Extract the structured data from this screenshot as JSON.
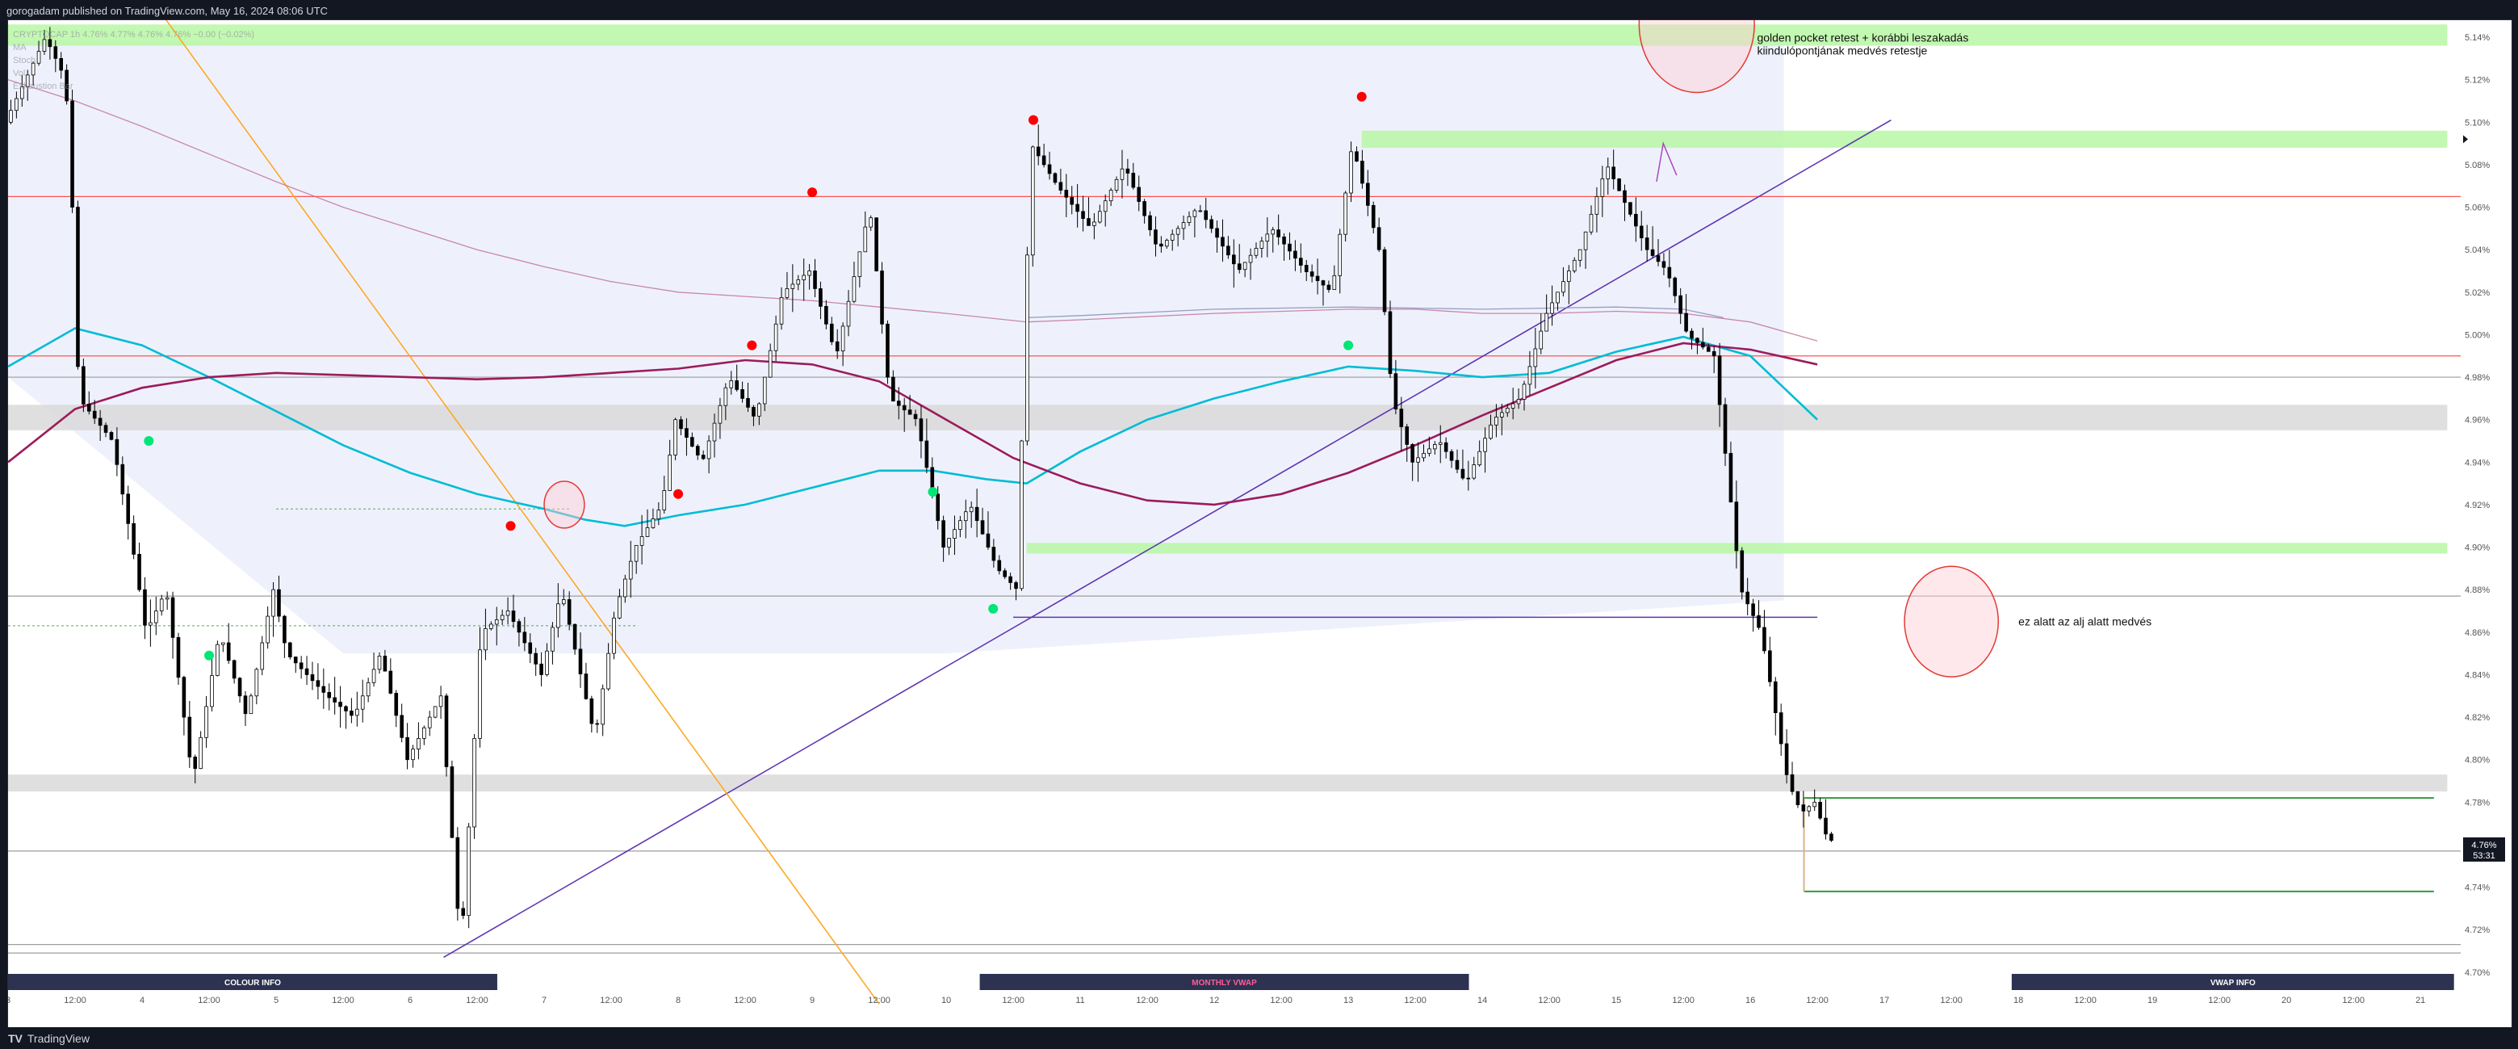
{
  "header": {
    "publish_line": "gorogadam published on TradingView.com, May 16, 2024 08:06 UTC"
  },
  "legend": {
    "symbol_line": "CRYPTOCAP 1h",
    "ohlc_line": "4.76% 4.77% 4.76% 4.76% −0.00 (−0.02%)",
    "items": [
      "MA",
      "Stoch",
      "Vol",
      "Exhaustion Bar"
    ]
  },
  "annotations": {
    "golden_pocket": [
      "golden pocket retest + korábbi leszakadás",
      "kiindulópontjának medvés retestje"
    ],
    "below_low": "ez alatt az alj alatt medvés"
  },
  "info_bars": {
    "left": "COLOUR INFO",
    "middle": "MONTHLY VWAP",
    "right": "VWAP INFO"
  },
  "price_labels": {
    "current": "4.76%",
    "countdown": "53:31"
  },
  "footer": {
    "logo_mark": "TV",
    "logo_text": "TradingView"
  },
  "chart_data": {
    "type": "candlestick",
    "title": "",
    "xlabel": "",
    "ylabel": "",
    "ylim": [
      4.695,
      5.148
    ],
    "y_ticks": [
      "4.70%",
      "4.72%",
      "4.74%",
      "4.76%",
      "4.78%",
      "4.80%",
      "4.82%",
      "4.84%",
      "4.86%",
      "4.88%",
      "4.90%",
      "4.92%",
      "4.94%",
      "4.96%",
      "4.98%",
      "5.00%",
      "5.02%",
      "5.04%",
      "5.06%",
      "5.08%",
      "5.10%",
      "5.12%",
      "5.14%"
    ],
    "y_tick_values": [
      4.7,
      4.72,
      4.74,
      4.76,
      4.78,
      4.8,
      4.82,
      4.84,
      4.86,
      4.88,
      4.9,
      4.92,
      4.94,
      4.96,
      4.98,
      5.0,
      5.02,
      5.04,
      5.06,
      5.08,
      5.1,
      5.12,
      5.14
    ],
    "x_range_days": [
      3.0,
      21.3
    ],
    "x_ticks": [
      {
        "t": 3.0,
        "label": "3"
      },
      {
        "t": 3.5,
        "label": "12:00"
      },
      {
        "t": 4.0,
        "label": "4"
      },
      {
        "t": 4.5,
        "label": "12:00"
      },
      {
        "t": 5.0,
        "label": "5"
      },
      {
        "t": 5.5,
        "label": "12:00"
      },
      {
        "t": 6.0,
        "label": "6"
      },
      {
        "t": 6.5,
        "label": "12:00"
      },
      {
        "t": 7.0,
        "label": "7"
      },
      {
        "t": 7.5,
        "label": "12:00"
      },
      {
        "t": 8.0,
        "label": "8"
      },
      {
        "t": 8.5,
        "label": "12:00"
      },
      {
        "t": 9.0,
        "label": "9"
      },
      {
        "t": 9.5,
        "label": "12:00"
      },
      {
        "t": 10.0,
        "label": "10"
      },
      {
        "t": 10.5,
        "label": "12:00"
      },
      {
        "t": 11.0,
        "label": "11"
      },
      {
        "t": 11.5,
        "label": "12:00"
      },
      {
        "t": 12.0,
        "label": "12"
      },
      {
        "t": 12.5,
        "label": "12:00"
      },
      {
        "t": 13.0,
        "label": "13"
      },
      {
        "t": 13.5,
        "label": "12:00"
      },
      {
        "t": 14.0,
        "label": "14"
      },
      {
        "t": 14.5,
        "label": "12:00"
      },
      {
        "t": 15.0,
        "label": "15"
      },
      {
        "t": 15.5,
        "label": "12:00"
      },
      {
        "t": 16.0,
        "label": "16"
      },
      {
        "t": 16.5,
        "label": "12:00"
      },
      {
        "t": 17.0,
        "label": "17"
      },
      {
        "t": 17.5,
        "label": "12:00"
      },
      {
        "t": 18.0,
        "label": "18"
      },
      {
        "t": 18.5,
        "label": "12:00"
      },
      {
        "t": 19.0,
        "label": "19"
      },
      {
        "t": 19.5,
        "label": "12:00"
      },
      {
        "t": 20.0,
        "label": "20"
      },
      {
        "t": 20.5,
        "label": "12:00"
      },
      {
        "t": 21.0,
        "label": "21"
      }
    ],
    "price_path": [
      [
        3.0,
        5.1
      ],
      [
        3.3,
        5.14
      ],
      [
        3.45,
        5.12
      ],
      [
        3.5,
        5.06
      ],
      [
        3.55,
        4.97
      ],
      [
        3.8,
        4.95
      ],
      [
        3.95,
        4.9
      ],
      [
        4.05,
        4.86
      ],
      [
        4.2,
        4.88
      ],
      [
        4.4,
        4.79
      ],
      [
        4.6,
        4.86
      ],
      [
        4.8,
        4.82
      ],
      [
        5.0,
        4.88
      ],
      [
        5.1,
        4.85
      ],
      [
        5.4,
        4.83
      ],
      [
        5.6,
        4.82
      ],
      [
        5.8,
        4.85
      ],
      [
        6.0,
        4.8
      ],
      [
        6.25,
        4.83
      ],
      [
        6.4,
        4.71
      ],
      [
        6.55,
        4.86
      ],
      [
        6.75,
        4.87
      ],
      [
        7.0,
        4.84
      ],
      [
        7.15,
        4.88
      ],
      [
        7.4,
        4.81
      ],
      [
        7.55,
        4.87
      ],
      [
        7.7,
        4.9
      ],
      [
        7.9,
        4.92
      ],
      [
        8.0,
        4.96
      ],
      [
        8.2,
        4.94
      ],
      [
        8.4,
        4.98
      ],
      [
        8.6,
        4.96
      ],
      [
        8.8,
        5.02
      ],
      [
        9.0,
        5.03
      ],
      [
        9.2,
        4.99
      ],
      [
        9.45,
        5.06
      ],
      [
        9.6,
        4.97
      ],
      [
        9.8,
        4.96
      ],
      [
        10.0,
        4.9
      ],
      [
        10.2,
        4.92
      ],
      [
        10.4,
        4.89
      ],
      [
        10.55,
        4.88
      ],
      [
        10.65,
        5.09
      ],
      [
        10.85,
        5.07
      ],
      [
        11.1,
        5.05
      ],
      [
        11.35,
        5.08
      ],
      [
        11.6,
        5.04
      ],
      [
        11.9,
        5.06
      ],
      [
        12.2,
        5.03
      ],
      [
        12.45,
        5.05
      ],
      [
        12.7,
        5.03
      ],
      [
        12.9,
        5.02
      ],
      [
        13.05,
        5.09
      ],
      [
        13.25,
        5.04
      ],
      [
        13.35,
        4.97
      ],
      [
        13.5,
        4.94
      ],
      [
        13.7,
        4.95
      ],
      [
        13.9,
        4.93
      ],
      [
        14.1,
        4.96
      ],
      [
        14.3,
        4.97
      ],
      [
        14.5,
        5.01
      ],
      [
        14.75,
        5.04
      ],
      [
        14.95,
        5.08
      ],
      [
        15.1,
        5.06
      ],
      [
        15.25,
        5.04
      ],
      [
        15.4,
        5.03
      ],
      [
        15.55,
        5.0
      ],
      [
        15.75,
        4.99
      ],
      [
        15.95,
        4.88
      ],
      [
        16.1,
        4.86
      ],
      [
        16.3,
        4.79
      ],
      [
        16.4,
        4.775
      ],
      [
        16.5,
        4.78
      ],
      [
        16.6,
        4.762
      ]
    ],
    "ma_series": [
      {
        "color": "#00bcd4",
        "points": [
          [
            3.0,
            4.985
          ],
          [
            3.5,
            5.003
          ],
          [
            4.0,
            4.995
          ],
          [
            4.5,
            4.98
          ],
          [
            5.0,
            4.964
          ],
          [
            5.5,
            4.948
          ],
          [
            6.0,
            4.935
          ],
          [
            6.5,
            4.925
          ],
          [
            7.0,
            4.918
          ],
          [
            7.3,
            4.913
          ],
          [
            7.6,
            4.91
          ],
          [
            8.0,
            4.915
          ],
          [
            8.5,
            4.92
          ],
          [
            9.0,
            4.928
          ],
          [
            9.5,
            4.936
          ],
          [
            9.9,
            4.936
          ],
          [
            10.3,
            4.932
          ],
          [
            10.6,
            4.93
          ],
          [
            11.0,
            4.945
          ],
          [
            11.5,
            4.96
          ],
          [
            12.0,
            4.97
          ],
          [
            12.5,
            4.978
          ],
          [
            13.0,
            4.985
          ],
          [
            13.5,
            4.983
          ],
          [
            14.0,
            4.98
          ],
          [
            14.5,
            4.982
          ],
          [
            15.0,
            4.992
          ],
          [
            15.5,
            4.999
          ],
          [
            16.0,
            4.99
          ],
          [
            16.5,
            4.96
          ]
        ]
      },
      {
        "color": "#9c1b5c",
        "points": [
          [
            3.0,
            4.94
          ],
          [
            3.5,
            4.965
          ],
          [
            4.0,
            4.975
          ],
          [
            4.5,
            4.98
          ],
          [
            5.0,
            4.982
          ],
          [
            5.5,
            4.981
          ],
          [
            6.0,
            4.98
          ],
          [
            6.5,
            4.979
          ],
          [
            7.0,
            4.98
          ],
          [
            7.5,
            4.982
          ],
          [
            8.0,
            4.984
          ],
          [
            8.5,
            4.988
          ],
          [
            9.0,
            4.986
          ],
          [
            9.5,
            4.978
          ],
          [
            10.0,
            4.96
          ],
          [
            10.5,
            4.942
          ],
          [
            11.0,
            4.93
          ],
          [
            11.5,
            4.922
          ],
          [
            12.0,
            4.92
          ],
          [
            12.5,
            4.925
          ],
          [
            13.0,
            4.935
          ],
          [
            13.5,
            4.948
          ],
          [
            14.0,
            4.962
          ],
          [
            14.5,
            4.975
          ],
          [
            15.0,
            4.988
          ],
          [
            15.5,
            4.996
          ],
          [
            16.0,
            4.993
          ],
          [
            16.5,
            4.986
          ]
        ]
      },
      {
        "color": "#c06c96",
        "points": [
          [
            3.0,
            5.12
          ],
          [
            3.5,
            5.11
          ],
          [
            4.0,
            5.098
          ],
          [
            4.5,
            5.085
          ],
          [
            5.0,
            5.072
          ],
          [
            5.5,
            5.06
          ],
          [
            6.0,
            5.05
          ],
          [
            6.5,
            5.04
          ],
          [
            7.0,
            5.032
          ],
          [
            7.5,
            5.025
          ],
          [
            8.0,
            5.02
          ],
          [
            8.5,
            5.018
          ],
          [
            9.0,
            5.016
          ],
          [
            9.5,
            5.013
          ],
          [
            10.0,
            5.01
          ],
          [
            10.6,
            5.006
          ],
          [
            11.0,
            5.007
          ],
          [
            12.0,
            5.01
          ],
          [
            13.0,
            5.012
          ],
          [
            13.5,
            5.012
          ],
          [
            14.0,
            5.01
          ],
          [
            14.5,
            5.01
          ],
          [
            15.0,
            5.011
          ],
          [
            15.5,
            5.01
          ],
          [
            16.0,
            5.006
          ],
          [
            16.5,
            4.997
          ]
        ]
      },
      {
        "color": "#7f8ab0",
        "points": [
          [
            10.6,
            5.008
          ],
          [
            11.0,
            5.009
          ],
          [
            12.0,
            5.012
          ],
          [
            13.0,
            5.013
          ],
          [
            14.0,
            5.012
          ],
          [
            15.0,
            5.013
          ],
          [
            15.5,
            5.012
          ],
          [
            15.8,
            5.008
          ]
        ]
      }
    ],
    "horizontal_lines": [
      {
        "y": 5.065,
        "color": "#ff5252"
      },
      {
        "y": 4.99,
        "color": "#ff5252"
      },
      {
        "y": 4.98,
        "color": "#9e9e9e"
      },
      {
        "y": 4.877,
        "color": "#9e9e9e"
      },
      {
        "y": 4.757,
        "color": "#9e9e9e"
      },
      {
        "y": 4.713,
        "color": "#9e9e9e"
      },
      {
        "y": 4.709,
        "color": "#9e9e9e"
      }
    ],
    "zones": [
      {
        "y1": 5.136,
        "y2": 5.146,
        "color": "#b7f7a3",
        "x1": 3.0,
        "x2": 21.2
      },
      {
        "y1": 5.088,
        "y2": 5.096,
        "color": "#b7f7a3",
        "x1": 13.1,
        "x2": 21.2
      },
      {
        "y1": 4.897,
        "y2": 4.902,
        "color": "#b7f7a3",
        "x1": 10.6,
        "x2": 21.2
      },
      {
        "y1": 4.955,
        "y2": 4.967,
        "color": "#d9d9d9",
        "x1": 3.0,
        "x2": 21.2
      },
      {
        "y1": 4.785,
        "y2": 4.793,
        "color": "#d9d9d9",
        "x1": 3.0,
        "x2": 21.2
      }
    ],
    "trendlines": [
      {
        "x1": 6.25,
        "y1": 4.707,
        "x2": 17.05,
        "y2": 5.101,
        "color": "#5e35b1"
      },
      {
        "x1": 4.1,
        "y1": 5.155,
        "x2": 9.5,
        "y2": 4.685,
        "color": "#ffa726"
      }
    ],
    "signal_dots": [
      {
        "x": 4.05,
        "y": 4.95,
        "color": "#00e676"
      },
      {
        "x": 4.5,
        "y": 4.849,
        "color": "#00e676"
      },
      {
        "x": 6.75,
        "y": 4.91,
        "color": "#ff0000"
      },
      {
        "x": 8.0,
        "y": 4.925,
        "color": "#ff0000"
      },
      {
        "x": 8.55,
        "y": 4.995,
        "color": "#ff0000"
      },
      {
        "x": 9.0,
        "y": 5.067,
        "color": "#ff0000"
      },
      {
        "x": 9.9,
        "y": 4.926,
        "color": "#00e676"
      },
      {
        "x": 10.35,
        "y": 4.871,
        "color": "#00e676"
      },
      {
        "x": 10.65,
        "y": 5.101,
        "color": "#ff0000"
      },
      {
        "x": 13.0,
        "y": 4.995,
        "color": "#00e676"
      },
      {
        "x": 13.1,
        "y": 5.112,
        "color": "#ff0000"
      }
    ],
    "circles": [
      {
        "x": 15.6,
        "y": 5.146,
        "rx": 0.43,
        "ry": 0.032
      },
      {
        "x": 17.5,
        "y": 4.865,
        "rx": 0.35,
        "ry": 0.026
      },
      {
        "x": 7.15,
        "y": 4.92,
        "rx": 0.15,
        "ry": 0.011
      }
    ],
    "current_price": 4.76
  }
}
